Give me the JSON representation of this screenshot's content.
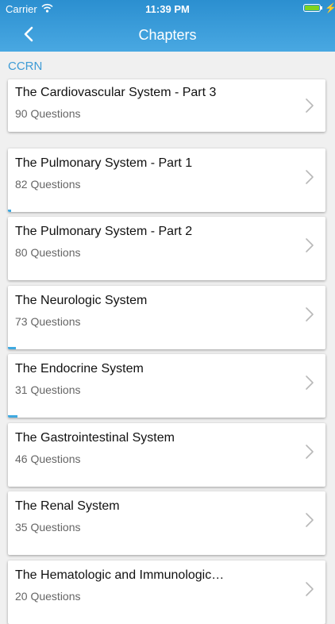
{
  "status_bar": {
    "carrier": "Carrier",
    "time": "11:39 PM",
    "battery_level": 1.0,
    "battery_color": "#7ed321"
  },
  "header": {
    "title": "Chapters",
    "back_icon": "chevron-left-icon",
    "accent": "#2b8fd0"
  },
  "section": {
    "label": "CCRN"
  },
  "chapters": [
    {
      "title": "The Cardiovascular System - Part 3",
      "subtitle": "90 Questions",
      "progress": 0.0
    },
    {
      "title": "The Pulmonary System - Part 1",
      "subtitle": "82 Questions",
      "progress": 0.01
    },
    {
      "title": "The Pulmonary System - Part 2",
      "subtitle": "80 Questions",
      "progress": 0.0
    },
    {
      "title": "The Neurologic System",
      "subtitle": "73 Questions",
      "progress": 0.025
    },
    {
      "title": "The Endocrine System",
      "subtitle": "31 Questions",
      "progress": 0.03
    },
    {
      "title": "The Gastrointestinal System",
      "subtitle": "46 Questions",
      "progress": 0.0
    },
    {
      "title": "The Renal System",
      "subtitle": "35 Questions",
      "progress": 0.0
    },
    {
      "title": "The Hematologic and Immunologic…",
      "subtitle": "20 Questions",
      "progress": 0.0
    }
  ]
}
